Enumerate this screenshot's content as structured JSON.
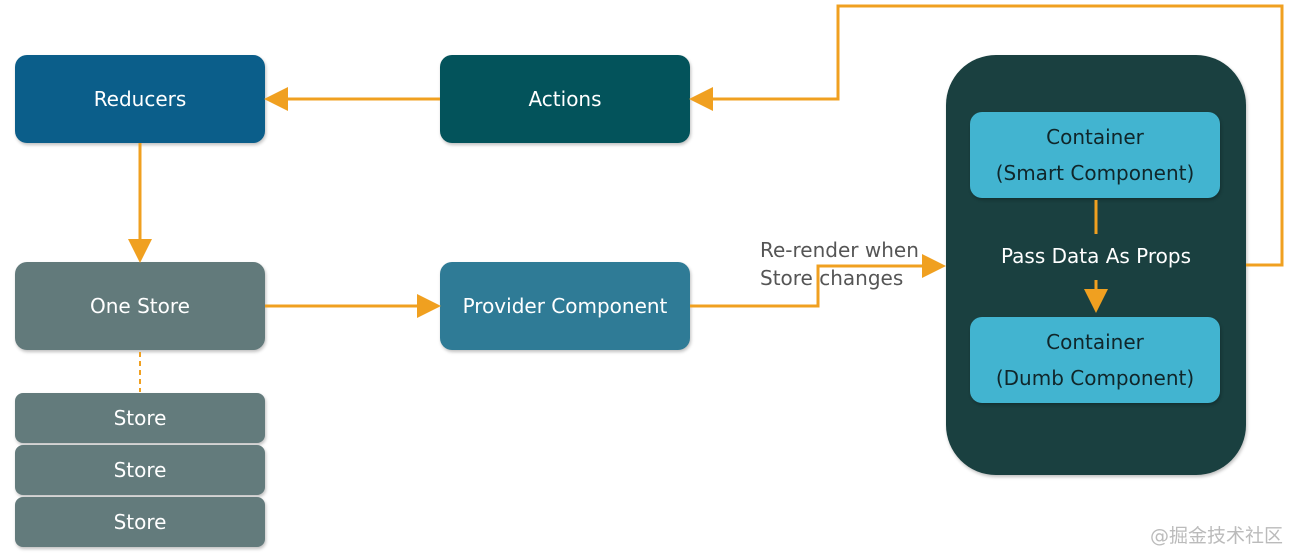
{
  "nodes": {
    "reducers": "Reducers",
    "actions": "Actions",
    "one_store": "One Store",
    "provider": "Provider Component",
    "stores": [
      "Store",
      "Store",
      "Store"
    ],
    "smart": {
      "line1": "Container",
      "line2": "(Smart Component)"
    },
    "dumb": {
      "line1": "Container",
      "line2": "(Dumb Component)"
    }
  },
  "edge_labels": {
    "rerender_line1": "Re-render when",
    "rerender_line2": "Store changes",
    "pass_props": "Pass Data As Props"
  },
  "watermark": "@掘金技术社区",
  "colors": {
    "arrow": "#f0a020",
    "reducers": "#0b5e8a",
    "actions": "#03535b",
    "store": "#637b7c",
    "provider": "#2f7b96",
    "container_group": "#1a4040",
    "container": "#42b4d0"
  }
}
